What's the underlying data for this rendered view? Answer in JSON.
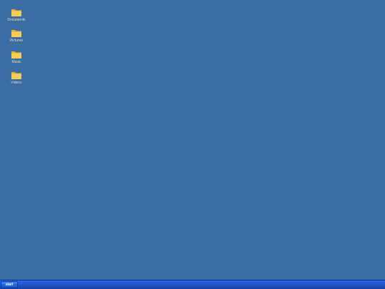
{
  "desktop": {
    "icons": [
      {
        "label": "Documents",
        "icon": "folder-icon"
      },
      {
        "label": "Pictures",
        "icon": "folder-icon"
      },
      {
        "label": "Music",
        "icon": "folder-icon"
      },
      {
        "label": "Videos",
        "icon": "folder-icon"
      }
    ]
  },
  "taskbar": {
    "start_label": "start"
  },
  "colors": {
    "desktop_background": "#3a6ea5",
    "folder": "#f5c542",
    "taskbar": "#245edb"
  }
}
